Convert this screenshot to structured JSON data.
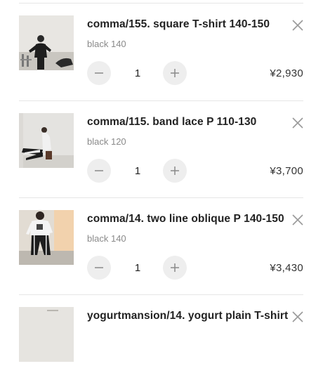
{
  "cart": {
    "items": [
      {
        "name": "comma/155. square T-shirt 140-150",
        "variant": "black 140",
        "quantity": "1",
        "price": "¥2,930",
        "image": "photo-child-black-outfit"
      },
      {
        "name": "comma/115. band lace P 110-130",
        "variant": "black 120",
        "quantity": "1",
        "price": "¥3,700",
        "image": "photo-child-band-lace-pants"
      },
      {
        "name": "comma/14. two line oblique P 140-150",
        "variant": "black 140",
        "quantity": "1",
        "price": "¥3,430",
        "image": "photo-child-two-line-pants"
      },
      {
        "name": "yogurtmansion/14. yogurt plain T-shirt",
        "variant": "",
        "quantity": "",
        "price": "",
        "image": "photo-yogurt-tshirt"
      }
    ],
    "icons": {
      "remove": "close-icon",
      "decrease": "minus-icon",
      "increase": "plus-icon"
    }
  }
}
